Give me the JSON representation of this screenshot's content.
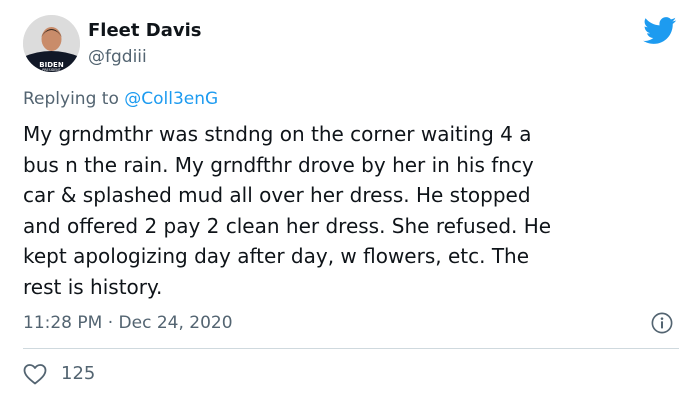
{
  "author": {
    "display_name": "Fleet Davis",
    "handle": "@fgdiii",
    "avatar_shirt_text": "BIDEN",
    "avatar_shirt_subtext": "PRESIDENT"
  },
  "reply": {
    "prefix": "Replying to ",
    "to": "@Coll3enG"
  },
  "tweet": {
    "text": "My grndmthr was stndng on the corner waiting 4 a\nbus n the rain.  My grndfthr drove by her in his fncy\ncar & splashed mud all over her dress.  He stopped\nand offered 2 pay 2 clean her dress.  She refused.  He\nkept apologizing day after day, w flowers, etc.  The\nrest is history.",
    "timestamp": "11:28 PM · Dec 24, 2020"
  },
  "stats": {
    "likes": "125"
  },
  "icons": {
    "brand": "twitter-bird-icon",
    "info": "info-icon",
    "like": "heart-icon"
  },
  "colors": {
    "brand_blue": "#1d9bf0",
    "text": "#0f1419",
    "secondary": "#536471",
    "divider": "#cfd9de"
  }
}
